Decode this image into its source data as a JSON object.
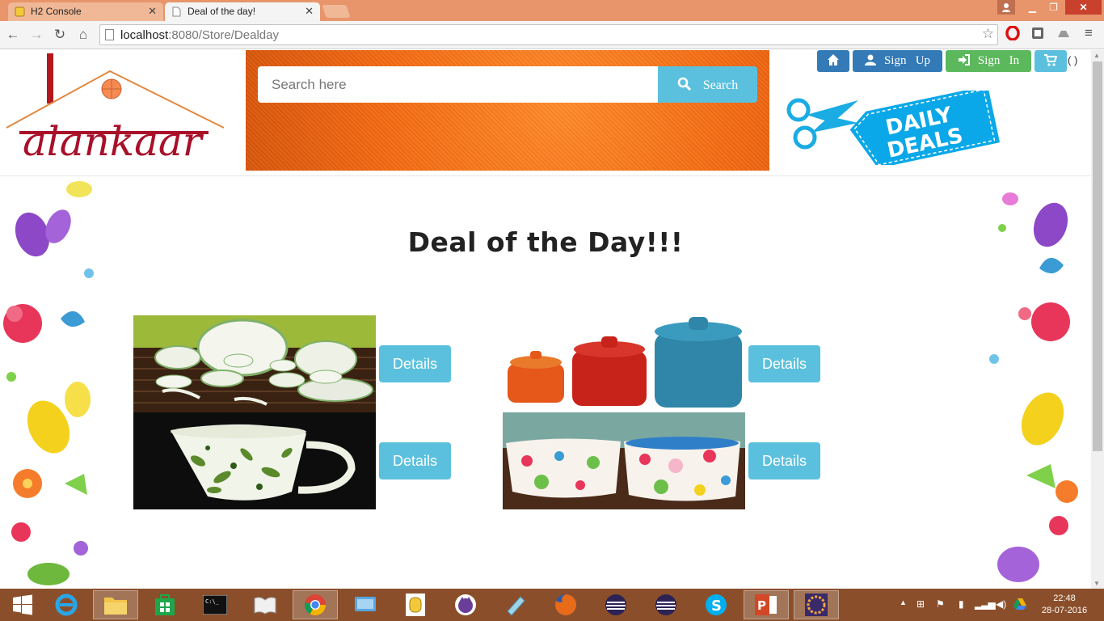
{
  "browser": {
    "tabs": [
      {
        "title": "H2 Console"
      },
      {
        "title": "Deal of the day!"
      }
    ],
    "url_host": "localhost",
    "url_rest": ":8080/Store/Dealday"
  },
  "header": {
    "search_placeholder": "Search here",
    "search_label": "Search",
    "signup_label": "Sign   Up",
    "signin_label": "Sign   In",
    "cart_count": "( )",
    "logo_text": "alankaar",
    "deals_text_1": "DAILY",
    "deals_text_2": "DEALS"
  },
  "main": {
    "title": "Deal of the Day!!!",
    "details_label": "Details"
  },
  "taskbar": {
    "time": "22:48",
    "date": "28-07-2016"
  },
  "colors": {
    "primary": "#337ab7",
    "success": "#5cb85c",
    "info": "#5bc0de",
    "brand": "#a8102a"
  }
}
